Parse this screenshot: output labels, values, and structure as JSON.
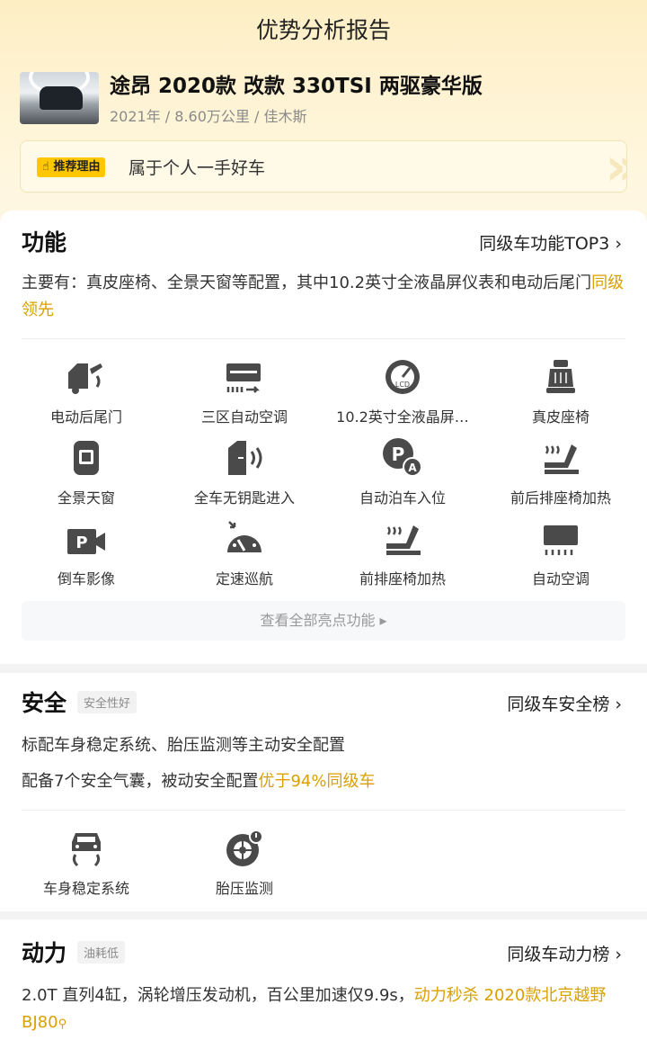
{
  "header": {
    "title": "优势分析报告",
    "car_name": "途昂 2020款 改款 330TSI 两驱豪华版",
    "car_meta": "2021年 / 8.60万公里 / 佳木斯",
    "reason_tag": "推荐理由",
    "reason_text": "属于个人一手好车"
  },
  "function": {
    "title": "功能",
    "link": "同级车功能TOP3 ›",
    "desc_main": "主要有：真皮座椅、全景天窗等配置，其中10.2英寸全液晶屏仪表和电动后尾门",
    "desc_highlight": "同级领先",
    "features": [
      {
        "label": "电动后尾门",
        "icon": "tailgate-icon"
      },
      {
        "label": "三区自动空调",
        "icon": "tri-zone-ac-icon"
      },
      {
        "label": "10.2英寸全液晶屏…",
        "icon": "lcd-gauge-icon"
      },
      {
        "label": "真皮座椅",
        "icon": "leather-seat-icon"
      },
      {
        "label": "全景天窗",
        "icon": "sunroof-icon"
      },
      {
        "label": "全车无钥匙进入",
        "icon": "keyless-entry-icon"
      },
      {
        "label": "自动泊车入位",
        "icon": "auto-parking-icon"
      },
      {
        "label": "前后排座椅加热",
        "icon": "seat-heating-icon"
      },
      {
        "label": "倒车影像",
        "icon": "reverse-camera-icon"
      },
      {
        "label": "定速巡航",
        "icon": "cruise-control-icon"
      },
      {
        "label": "前排座椅加热",
        "icon": "front-seat-heating-icon"
      },
      {
        "label": "自动空调",
        "icon": "auto-ac-icon"
      }
    ],
    "more": "查看全部亮点功能 ▸"
  },
  "safety": {
    "title": "安全",
    "tag": "安全性好",
    "link": "同级车安全榜 ›",
    "line1": "标配车身稳定系统、胎压监测等主动安全配置",
    "line2_main": "配备7个安全气囊，被动安全配置",
    "line2_highlight": "优于94%同级车",
    "features": [
      {
        "label": "车身稳定系统",
        "icon": "stability-control-icon"
      },
      {
        "label": "胎压监测",
        "icon": "tire-pressure-icon"
      }
    ]
  },
  "power": {
    "title": "动力",
    "tag": "油耗低",
    "link": "同级车动力榜 ›",
    "desc_main": "2.0T 直列4缸，涡轮增压发动机，百公里加速仅9.9s，",
    "desc_highlight": "动力秒杀 2020款北京越野BJ80"
  },
  "colors": {
    "accent": "#d9a000",
    "tag_yellow": "#ffc700",
    "icon": "#4a4a4a"
  }
}
